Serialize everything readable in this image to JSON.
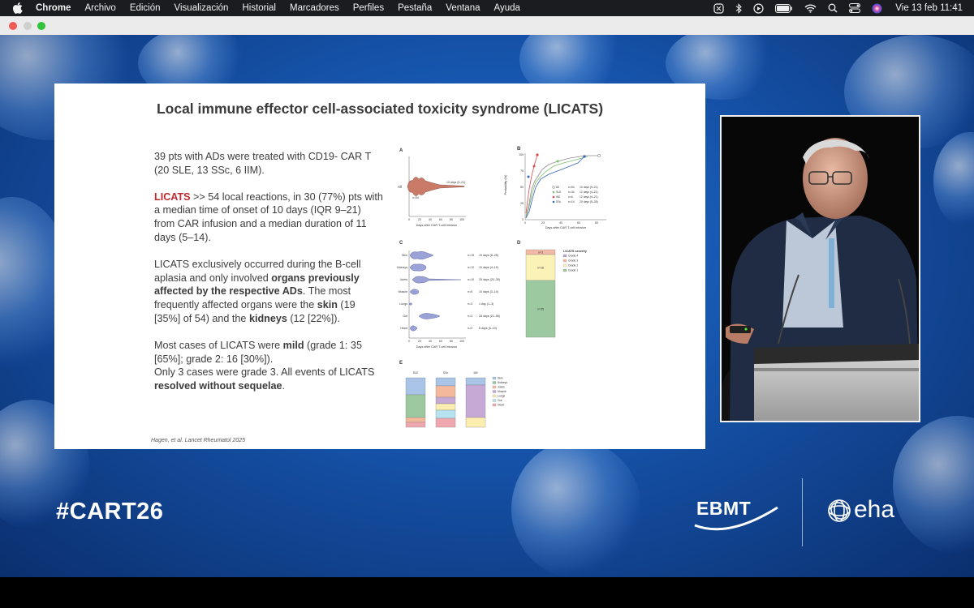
{
  "menubar": {
    "app": "Chrome",
    "menus": [
      "Archivo",
      "Edición",
      "Visualización",
      "Historial",
      "Marcadores",
      "Perfiles",
      "Pestaña",
      "Ventana",
      "Ayuda"
    ],
    "clock": "Vie 13 feb 11:41",
    "status_icons": [
      "settings-icon",
      "bluetooth-icon",
      "play-icon",
      "battery-icon",
      "wifi-icon",
      "search-icon",
      "control-center-icon",
      "siri-icon"
    ]
  },
  "slide": {
    "title": "Local immune effector cell-associated toxicity syndrome (LICATS)",
    "p1": "39 pts with ADs were treated with CD19- CAR T (20 SLE, 13 SSc, 6 IIM).",
    "p2_highlight": "LICATS",
    "p2_rest": " >> 54 local reactions, in 30 (77%) pts with a median time of onset of 10 days (IQR 9–21) from CAR infusion and a median duration of 11 days (5–14).",
    "p3_a": "LICATS exclusively occurred during the B-cell aplasia and only involved ",
    "p3_b": "organs previously affected by the respective ADs",
    "p3_c": ". The most frequently affected organs were the ",
    "p3_d": "skin",
    "p3_e": " (19 [35%] of 54) and the ",
    "p3_f": "kidneys",
    "p3_g": " (12 [22%]).",
    "p4_a": "Most cases of LICATS were ",
    "p4_b": "mild",
    "p4_c": " (grade 1: 35 [65%]; grade 2: 16 [30%]).",
    "p4_d": "Only 3 cases were grade 3. All events of LICATS ",
    "p4_e": "resolved without sequelae",
    "p4_f": ".",
    "citation": "Hagen, et al. Lancet Rheumatol 2025"
  },
  "figure": {
    "panel_labels": [
      "A",
      "B",
      "C",
      "D",
      "E"
    ],
    "a": {
      "row_label": "All",
      "n": "n=54",
      "median": "10 days (9–21)",
      "xticks": [
        "0",
        "20",
        "40",
        "60",
        "80",
        "100"
      ],
      "xlabel": "Days after CAR T-cell infusion"
    },
    "b": {
      "ylabel": "Probability (%)",
      "yticks": [
        "0",
        "25",
        "50",
        "75",
        "100"
      ],
      "xticks": [
        "0",
        "20",
        "40",
        "60",
        "80"
      ],
      "xlabel": "Days after CAR T-cell infusion",
      "legend": [
        {
          "name": "All",
          "n": "n=54",
          "median": "10 days (9–21)",
          "color": "#8c8c8c"
        },
        {
          "name": "SLE",
          "n": "n=34",
          "median": "12 days (4–21)",
          "color": "#7cbf6a"
        },
        {
          "name": "IIM",
          "n": "n=6",
          "median": "12 days (4–21)",
          "color": "#d94a4a"
        },
        {
          "name": "SSc",
          "n": "n=14",
          "median": "20 days (5–28)",
          "color": "#3a62b8"
        }
      ]
    },
    "c": {
      "rows": [
        {
          "label": "Skin",
          "n": "n=19",
          "median": "19 days (5–28)"
        },
        {
          "label": "Kidneys",
          "n": "n=12",
          "median": "10 days (4–19)"
        },
        {
          "label": "Joints",
          "n": "n=10",
          "median": "25 days (20–35)"
        },
        {
          "label": "Muscle",
          "n": "n=5",
          "median": "10 days (3–10)"
        },
        {
          "label": "Lungs",
          "n": "n=3",
          "median": "1 day (1–3)"
        },
        {
          "label": "Gut",
          "n": "n=3",
          "median": "28 days (21–56)"
        },
        {
          "label": "Heart",
          "n": "n=2",
          "median": "8 days (5–10)"
        }
      ],
      "xticks": [
        "0",
        "20",
        "40",
        "60",
        "80",
        "100"
      ],
      "xlabel": "Days after CAR T-cell infusion"
    },
    "d": {
      "legend_title": "LICATS severity",
      "legend": [
        {
          "name": "Grade 4",
          "color": "#b9a6cf"
        },
        {
          "name": "Grade 3",
          "color": "#f2b9a4"
        },
        {
          "name": "Grade 2",
          "color": "#fbf2b8"
        },
        {
          "name": "Grade 1",
          "color": "#9dc9a1"
        }
      ],
      "segments": [
        {
          "grade": "Grade 3",
          "n": 3,
          "label": "n=3",
          "color": "#f2b9a4"
        },
        {
          "grade": "Grade 2",
          "n": 16,
          "label": "n=16",
          "color": "#fbf2b8"
        },
        {
          "grade": "Grade 1",
          "n": 35,
          "label": "n=35",
          "color": "#9dc9a1"
        }
      ]
    },
    "e": {
      "columns": [
        "SLE",
        "SSc",
        "IIM"
      ],
      "legend": [
        {
          "name": "Skin",
          "color": "#a9c4e6"
        },
        {
          "name": "Kidneys",
          "color": "#9dc9a1"
        },
        {
          "name": "Joints",
          "color": "#f4b99c"
        },
        {
          "name": "Muscle",
          "color": "#c7a9d6"
        },
        {
          "name": "Lungs",
          "color": "#fbeeb0"
        },
        {
          "name": "Gut",
          "color": "#b7e2f0"
        },
        {
          "name": "Heart",
          "color": "#f0a8b0"
        }
      ]
    }
  },
  "overlay": {
    "hashtag": "#CART26",
    "logo_ebmt": "EBMT",
    "logo_eha": "eha"
  }
}
